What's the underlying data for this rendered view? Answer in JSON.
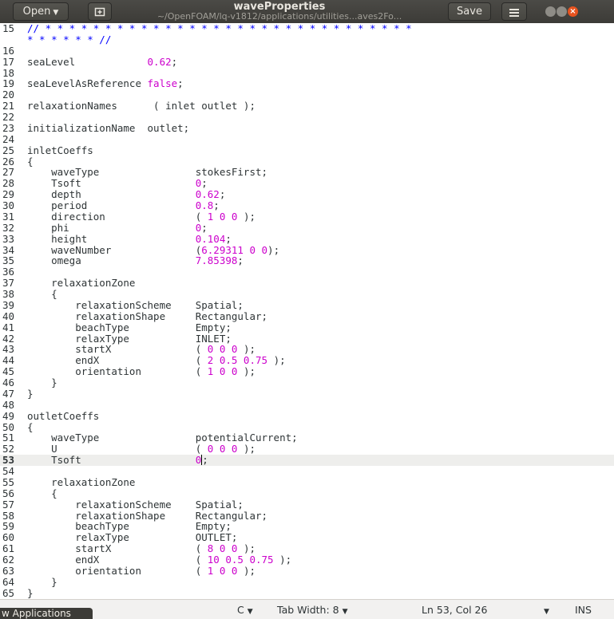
{
  "header": {
    "open_label": "Open",
    "title": "waveProperties",
    "subtitle": "~/OpenFOAM/lq-v1812/applications/utilities...aves2Fo...",
    "save_label": "Save"
  },
  "editor": {
    "lines": [
      {
        "n": "15",
        "segs": [
          {
            "t": "// * * * * * * * * * * * * * * * * * * * * * * * * * * * * * * *",
            "c": "cm"
          }
        ]
      },
      {
        "n": "",
        "segs": [
          {
            "t": "* * * * * * //",
            "c": "cm"
          }
        ]
      },
      {
        "n": "16",
        "segs": []
      },
      {
        "n": "17",
        "segs": [
          {
            "t": "seaLevel            "
          },
          {
            "t": "0.62",
            "c": "val"
          },
          {
            "t": ";"
          }
        ]
      },
      {
        "n": "18",
        "segs": []
      },
      {
        "n": "19",
        "segs": [
          {
            "t": "seaLevelAsReference "
          },
          {
            "t": "false",
            "c": "kw"
          },
          {
            "t": ";"
          }
        ]
      },
      {
        "n": "20",
        "segs": []
      },
      {
        "n": "21",
        "segs": [
          {
            "t": "relaxationNames      ( inlet outlet );"
          }
        ]
      },
      {
        "n": "22",
        "segs": []
      },
      {
        "n": "23",
        "segs": [
          {
            "t": "initializationName  outlet;"
          }
        ]
      },
      {
        "n": "24",
        "segs": []
      },
      {
        "n": "25",
        "segs": [
          {
            "t": "inletCoeffs"
          }
        ]
      },
      {
        "n": "26",
        "segs": [
          {
            "t": "{"
          }
        ]
      },
      {
        "n": "27",
        "segs": [
          {
            "t": "    waveType                stokesFirst;"
          }
        ]
      },
      {
        "n": "28",
        "segs": [
          {
            "t": "    Tsoft                   "
          },
          {
            "t": "0",
            "c": "val"
          },
          {
            "t": ";"
          }
        ]
      },
      {
        "n": "29",
        "segs": [
          {
            "t": "    depth                   "
          },
          {
            "t": "0.62",
            "c": "val"
          },
          {
            "t": ";"
          }
        ]
      },
      {
        "n": "30",
        "segs": [
          {
            "t": "    period                  "
          },
          {
            "t": "0.8",
            "c": "val"
          },
          {
            "t": ";"
          }
        ]
      },
      {
        "n": "31",
        "segs": [
          {
            "t": "    direction               ( "
          },
          {
            "t": "1 0 0",
            "c": "val"
          },
          {
            "t": " );"
          }
        ]
      },
      {
        "n": "32",
        "segs": [
          {
            "t": "    phi                     "
          },
          {
            "t": "0",
            "c": "val"
          },
          {
            "t": ";"
          }
        ]
      },
      {
        "n": "33",
        "segs": [
          {
            "t": "    height                  "
          },
          {
            "t": "0.104",
            "c": "val"
          },
          {
            "t": ";"
          }
        ]
      },
      {
        "n": "34",
        "segs": [
          {
            "t": "    waveNumber              ("
          },
          {
            "t": "6.29311 0 0",
            "c": "val"
          },
          {
            "t": ");"
          }
        ]
      },
      {
        "n": "35",
        "segs": [
          {
            "t": "    omega                   "
          },
          {
            "t": "7.85398",
            "c": "val"
          },
          {
            "t": ";"
          }
        ]
      },
      {
        "n": "36",
        "segs": []
      },
      {
        "n": "37",
        "segs": [
          {
            "t": "    relaxationZone"
          }
        ]
      },
      {
        "n": "38",
        "segs": [
          {
            "t": "    {"
          }
        ]
      },
      {
        "n": "39",
        "segs": [
          {
            "t": "        relaxationScheme    Spatial;"
          }
        ]
      },
      {
        "n": "40",
        "segs": [
          {
            "t": "        relaxationShape     Rectangular;"
          }
        ]
      },
      {
        "n": "41",
        "segs": [
          {
            "t": "        beachType           Empty;"
          }
        ]
      },
      {
        "n": "42",
        "segs": [
          {
            "t": "        relaxType           INLET;"
          }
        ]
      },
      {
        "n": "43",
        "segs": [
          {
            "t": "        startX              ( "
          },
          {
            "t": "0 0 0",
            "c": "val"
          },
          {
            "t": " );"
          }
        ]
      },
      {
        "n": "44",
        "segs": [
          {
            "t": "        endX                ( "
          },
          {
            "t": "2 0.5 0.75",
            "c": "val"
          },
          {
            "t": " );"
          }
        ]
      },
      {
        "n": "45",
        "segs": [
          {
            "t": "        orientation         ( "
          },
          {
            "t": "1 0 0",
            "c": "val"
          },
          {
            "t": " );"
          }
        ]
      },
      {
        "n": "46",
        "segs": [
          {
            "t": "    }"
          }
        ]
      },
      {
        "n": "47",
        "segs": [
          {
            "t": "}"
          }
        ]
      },
      {
        "n": "48",
        "segs": []
      },
      {
        "n": "49",
        "segs": [
          {
            "t": "outletCoeffs"
          }
        ]
      },
      {
        "n": "50",
        "segs": [
          {
            "t": "{"
          }
        ]
      },
      {
        "n": "51",
        "segs": [
          {
            "t": "    waveType                potentialCurrent;"
          }
        ]
      },
      {
        "n": "52",
        "segs": [
          {
            "t": "    U                       ( "
          },
          {
            "t": "0 0 0",
            "c": "val"
          },
          {
            "t": " );"
          }
        ]
      },
      {
        "n": "53",
        "current": true,
        "segs": [
          {
            "t": "    Tsoft                   "
          },
          {
            "t": "0",
            "c": "val"
          },
          {
            "t": "|",
            "c": "cursor"
          },
          {
            "t": ";"
          }
        ]
      },
      {
        "n": "54",
        "segs": []
      },
      {
        "n": "55",
        "segs": [
          {
            "t": "    relaxationZone"
          }
        ]
      },
      {
        "n": "56",
        "segs": [
          {
            "t": "    {"
          }
        ]
      },
      {
        "n": "57",
        "segs": [
          {
            "t": "        relaxationScheme    Spatial;"
          }
        ]
      },
      {
        "n": "58",
        "segs": [
          {
            "t": "        relaxationShape     Rectangular;"
          }
        ]
      },
      {
        "n": "59",
        "segs": [
          {
            "t": "        beachType           Empty;"
          }
        ]
      },
      {
        "n": "60",
        "segs": [
          {
            "t": "        relaxType           OUTLET;"
          }
        ]
      },
      {
        "n": "61",
        "segs": [
          {
            "t": "        startX              ( "
          },
          {
            "t": "8 0 0",
            "c": "val"
          },
          {
            "t": " );"
          }
        ]
      },
      {
        "n": "62",
        "segs": [
          {
            "t": "        endX                ( "
          },
          {
            "t": "10 0.5 0.75",
            "c": "val"
          },
          {
            "t": " );"
          }
        ]
      },
      {
        "n": "63",
        "segs": [
          {
            "t": "        orientation         ( "
          },
          {
            "t": "1 0 0",
            "c": "val"
          },
          {
            "t": " );"
          }
        ]
      },
      {
        "n": "64",
        "segs": [
          {
            "t": "    }"
          }
        ]
      },
      {
        "n": "65",
        "segs": [
          {
            "t": "}"
          }
        ]
      }
    ]
  },
  "statusbar": {
    "language": "C",
    "tab_width": "Tab Width: 8",
    "position": "Ln 53, Col 26",
    "insert_mode": "INS"
  },
  "taskbar": {
    "label": "w Applications"
  },
  "colors": {
    "value_highlight": "#cc00cc",
    "comment": "#0000ff",
    "close_button": "#e7531f"
  }
}
